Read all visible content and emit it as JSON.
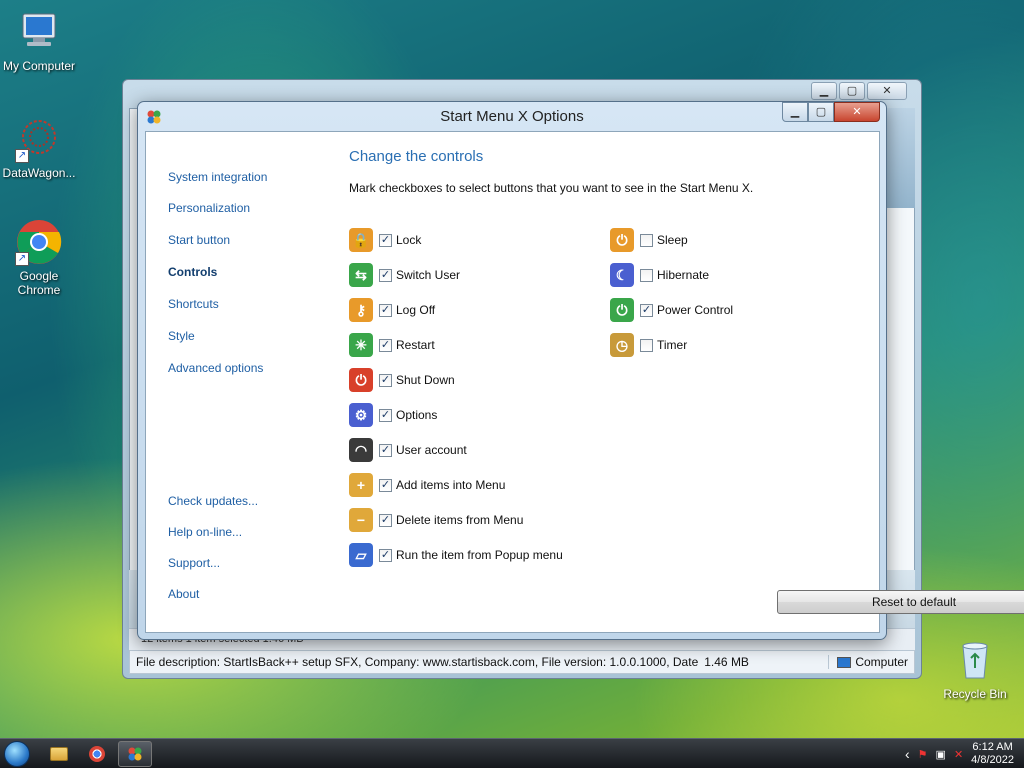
{
  "desktop": {
    "icons": [
      {
        "label": "My Computer"
      },
      {
        "label": "DataWagon..."
      },
      {
        "label": "Google\nChrome"
      },
      {
        "label": "Recycle Bin"
      }
    ]
  },
  "background_window": {
    "status_left": "File description: StartIsBack++ setup SFX, Company: www.startisback.com, File version: 1.0.0.1000, Date",
    "status_size": "1.46 MB",
    "status_location": "Computer",
    "strip_text": "12 items    1 item selected  1.46 MB"
  },
  "dialog": {
    "title": "Start Menu X Options",
    "nav": [
      {
        "label": "System integration",
        "active": false
      },
      {
        "label": "Personalization",
        "active": false
      },
      {
        "label": "Start button",
        "active": false
      },
      {
        "label": "Controls",
        "active": true
      },
      {
        "label": "Shortcuts",
        "active": false
      },
      {
        "label": "Style",
        "active": false
      },
      {
        "label": "Advanced options",
        "active": false
      }
    ],
    "nav_bottom": [
      {
        "label": "Check updates..."
      },
      {
        "label": "Help on-line..."
      },
      {
        "label": "Support..."
      },
      {
        "label": "About"
      }
    ],
    "heading": "Change the controls",
    "description": "Mark checkboxes to select buttons that you want to see in the Start Menu X.",
    "options_left": [
      {
        "label": "Lock",
        "checked": true,
        "icon": "lock-icon",
        "color": "#e89a2a"
      },
      {
        "label": "Switch User",
        "checked": true,
        "icon": "switch-user-icon",
        "color": "#3aa64a"
      },
      {
        "label": "Log Off",
        "checked": true,
        "icon": "key-icon",
        "color": "#e89a2a"
      },
      {
        "label": "Restart",
        "checked": true,
        "icon": "restart-icon",
        "color": "#3aa64a"
      },
      {
        "label": "Shut Down",
        "checked": true,
        "icon": "power-icon",
        "color": "#d8402a"
      },
      {
        "label": "Options",
        "checked": true,
        "icon": "gear-icon",
        "color": "#4a5fd0"
      },
      {
        "label": "User account",
        "checked": true,
        "icon": "user-account-icon",
        "color": "#3a3a3a"
      },
      {
        "label": "Add items into Menu",
        "checked": true,
        "icon": "add-item-icon",
        "color": "#e0a83a"
      },
      {
        "label": "Delete items from Menu",
        "checked": true,
        "icon": "delete-item-icon",
        "color": "#e0a83a"
      },
      {
        "label": "Run the item from Popup menu",
        "checked": true,
        "icon": "popup-run-icon",
        "color": "#3a6ad0"
      }
    ],
    "options_right": [
      {
        "label": "Sleep",
        "checked": false,
        "icon": "sleep-icon",
        "color": "#e89a2a"
      },
      {
        "label": "Hibernate",
        "checked": false,
        "icon": "hibernate-icon",
        "color": "#4a5fd0"
      },
      {
        "label": "Power Control",
        "checked": true,
        "icon": "power-control-icon",
        "color": "#3aa64a"
      },
      {
        "label": "Timer",
        "checked": false,
        "icon": "timer-icon",
        "color": "#c89a3a"
      }
    ],
    "reset_label": "Reset to default"
  },
  "taskbar": {
    "time": "6:12 AM",
    "date": "4/8/2022"
  }
}
